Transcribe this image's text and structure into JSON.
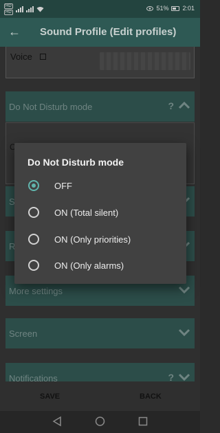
{
  "status_bar": {
    "battery": "51%",
    "time": "2:01"
  },
  "app_bar": {
    "title": "Sound Profile (Edit profiles)"
  },
  "voice": {
    "label": "Voice"
  },
  "sections": {
    "dnd": {
      "label": "Do Not Disturb mode",
      "help": "?"
    },
    "dnd_body_text": "C",
    "s": {
      "label": "S"
    },
    "r": {
      "label": "R"
    },
    "more": {
      "label": "More settings"
    },
    "screen": {
      "label": "Screen"
    },
    "notifications": {
      "label": "Notifications",
      "help": "?"
    }
  },
  "actions": {
    "save": "SAVE",
    "back": "BACK"
  },
  "dialog": {
    "title": "Do Not Disturb mode",
    "options": [
      {
        "label": "OFF",
        "selected": true
      },
      {
        "label": "ON (Total silent)",
        "selected": false
      },
      {
        "label": "ON (Only priorities)",
        "selected": false
      },
      {
        "label": "ON (Only alarms)",
        "selected": false
      }
    ]
  },
  "colors": {
    "accent": "#61b5ad",
    "section": "#2c4d49",
    "appbar": "#2e5954"
  }
}
